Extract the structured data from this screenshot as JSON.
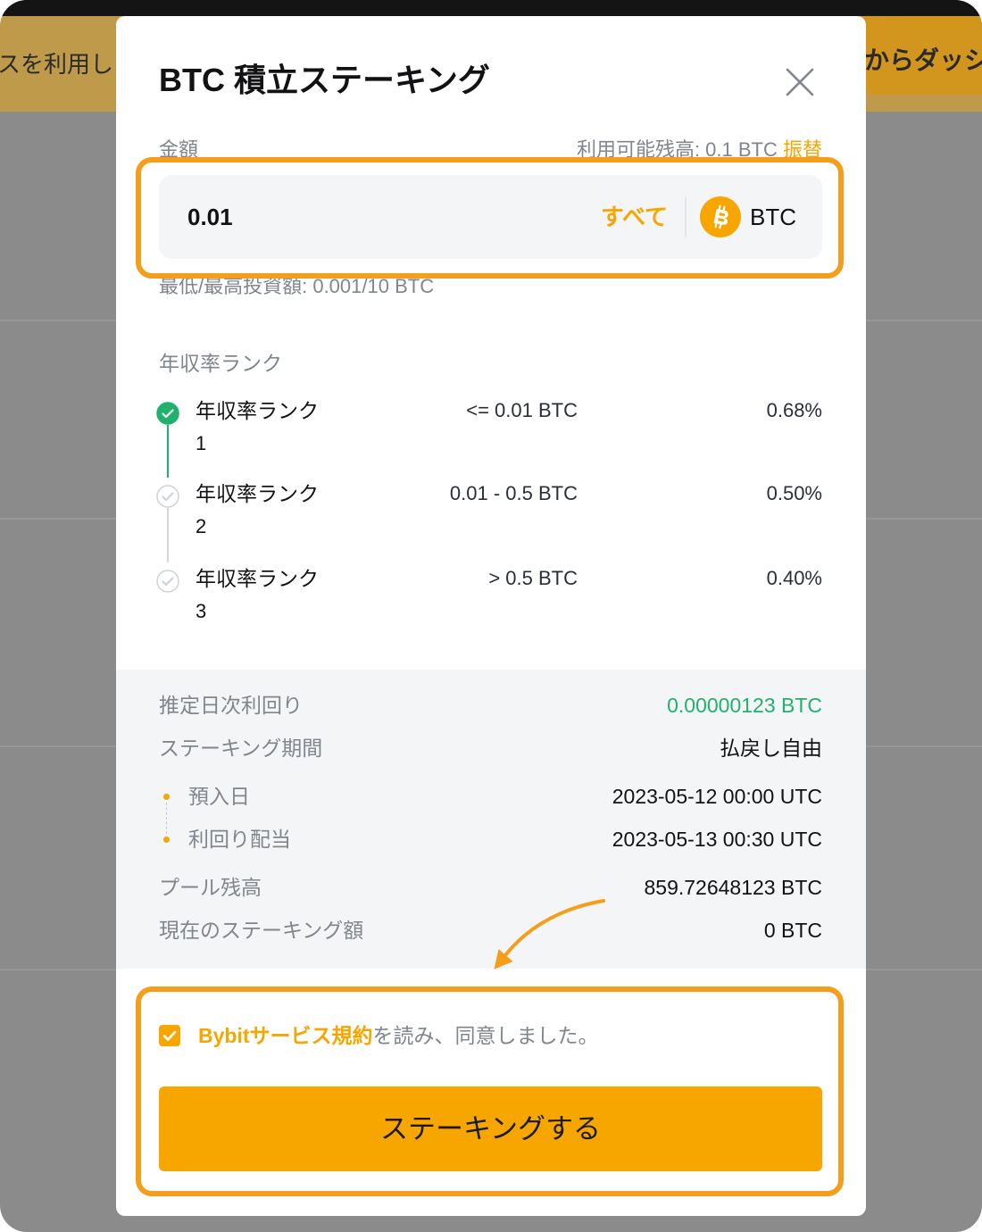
{
  "background": {
    "banner_left_text": "スを利用し",
    "banner_right_text": "からダッシ"
  },
  "modal": {
    "title": "BTC 積立ステーキング",
    "close_icon": "close-icon",
    "amount": {
      "label": "金額",
      "available_label": "利用可能残高: 0.1 BTC",
      "transfer_label": "振替",
      "value": "0.01",
      "max_label": "すべて",
      "coin_icon": "bitcoin-icon",
      "coin": "BTC",
      "limits": "最低/最高投資額: 0.001/10 BTC"
    },
    "apr_tiers": {
      "title": "年収率ランク",
      "items": [
        {
          "label": "年収率ランク",
          "number": "1",
          "range": "<= 0.01 BTC",
          "rate": "0.68%",
          "reached": true
        },
        {
          "label": "年収率ランク",
          "number": "2",
          "range": "0.01 - 0.5 BTC",
          "rate": "0.50%",
          "reached": false
        },
        {
          "label": "年収率ランク",
          "number": "3",
          "range": "> 0.5 BTC",
          "rate": "0.40%",
          "reached": false
        }
      ]
    },
    "summary": {
      "est_daily_yield": {
        "label": "推定日次利回り",
        "value": "0.00000123 BTC"
      },
      "staking_period": {
        "label": "ステーキング期間",
        "value": "払戻し自由"
      },
      "deposit_date": {
        "label": "預入日",
        "value": "2023-05-12 00:00 UTC"
      },
      "yield_distribution": {
        "label": "利回り配当",
        "value": "2023-05-13 00:30 UTC"
      },
      "pool_balance": {
        "label": "プール残高",
        "value": "859.72648123 BTC"
      },
      "current_staking": {
        "label": "現在のステーキング額",
        "value": "0 BTC"
      }
    },
    "agreement": {
      "checked": true,
      "terms_link": "Bybitサービス規約",
      "text": "を読み、同意しました。"
    },
    "submit_label": "ステーキングする"
  },
  "annotations": {
    "arrow_icon": "curved-arrow-icon"
  },
  "colors": {
    "accent": "#f7a600",
    "highlight": "#f59e1c",
    "positive": "#20b26c",
    "text_primary": "#121214",
    "text_secondary": "#81858c"
  }
}
